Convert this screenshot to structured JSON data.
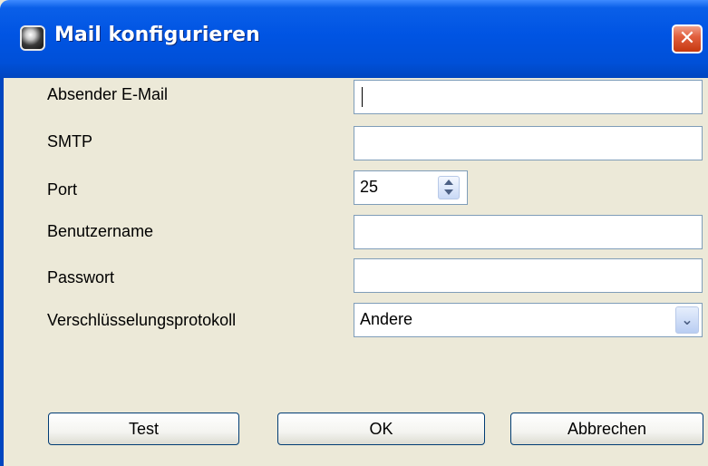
{
  "window": {
    "title": "Mail konfigurieren",
    "close_glyph": "✕",
    "app_icon": "mail-app-icon"
  },
  "form": {
    "sender_email": {
      "label": "Absender E-Mail",
      "value": ""
    },
    "smtp": {
      "label": "SMTP",
      "value": ""
    },
    "port": {
      "label": "Port",
      "value": "25"
    },
    "username": {
      "label": "Benutzername",
      "value": ""
    },
    "password": {
      "label": "Passwort",
      "value": ""
    },
    "encryption": {
      "label": "Verschlüsselungsprotokoll",
      "value": "Andere"
    }
  },
  "buttons": {
    "test": "Test",
    "ok": "OK",
    "cancel": "Abbrechen"
  },
  "colors": {
    "titlebar": "#0054e3",
    "client_bg": "#ece9d8",
    "field_border": "#7f9db9",
    "close_button": "#e2603f"
  }
}
